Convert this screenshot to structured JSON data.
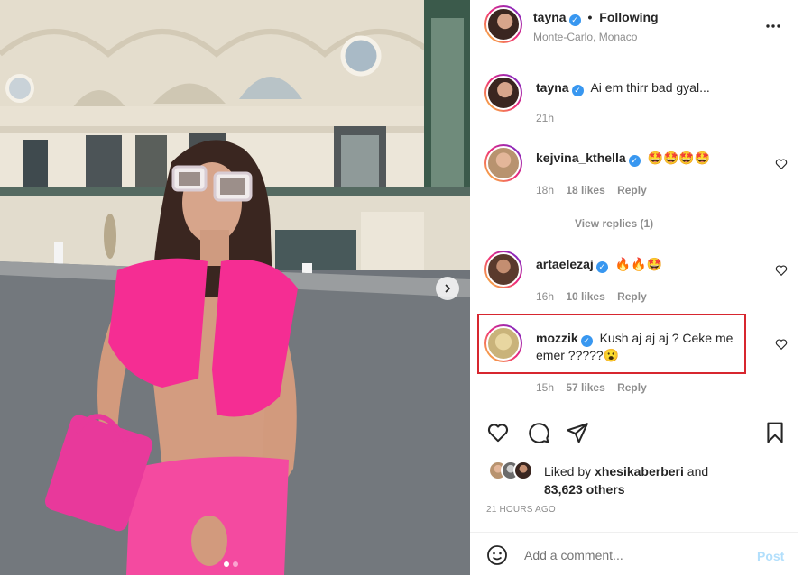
{
  "post": {
    "username": "tayna",
    "follow_status": "Following",
    "location": "Monte-Carlo, Monaco"
  },
  "caption": {
    "username": "tayna",
    "text": "Ai em thirr bad gyal...",
    "time": "21h"
  },
  "comments": [
    {
      "username": "kejvina_kthella",
      "text": "🤩🤩🤩🤩",
      "time": "18h",
      "likes": "18 likes",
      "reply": "Reply",
      "view_replies": "View replies (1)"
    },
    {
      "username": "artaelezaj",
      "text": "🔥🔥🤩",
      "time": "16h",
      "likes": "10 likes",
      "reply": "Reply"
    },
    {
      "username": "mozzik",
      "text": "Kush aj aj aj ? Ceke me emer ?????😮",
      "time": "15h",
      "likes": "57 likes",
      "reply": "Reply"
    }
  ],
  "likes": {
    "prefix": "Liked by",
    "user": "xhesikaberberi",
    "joiner": "and",
    "count": "83,623 others"
  },
  "timestamp": "21 HOURS AGO",
  "add_comment": {
    "placeholder": "Add a comment...",
    "post_label": "Post"
  },
  "icons": [
    "more-icon",
    "heart-icon",
    "comment-icon",
    "share-icon",
    "bookmark-icon",
    "emoji-icon",
    "verified-icon",
    "next-arrow-icon"
  ],
  "colors": {
    "verified": "#3897f0",
    "highlight": "#d7262f",
    "post_button": "#b2dffc"
  }
}
